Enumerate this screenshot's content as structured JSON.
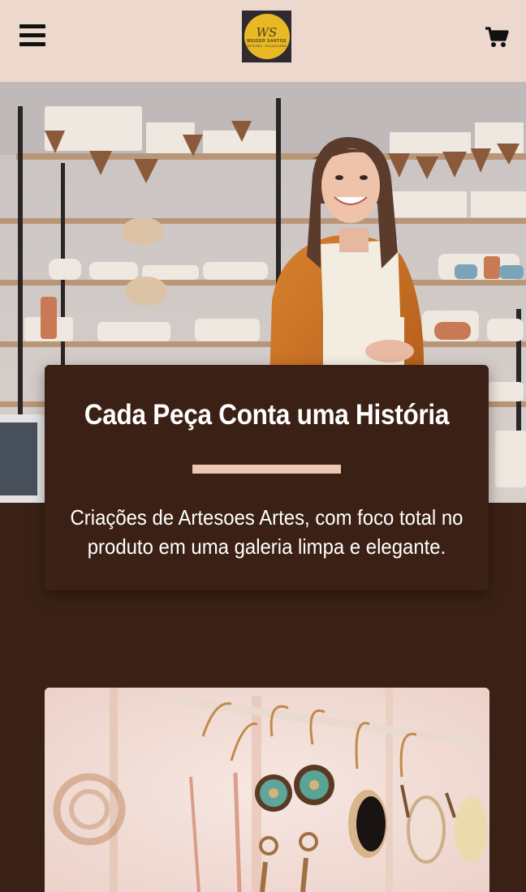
{
  "header": {
    "logo": {
      "monogram": "WS",
      "line1": "WEIDER SANTOS",
      "line2": "ARTESÃO · ESCULTURAS",
      "brand_color": "#e8b925"
    },
    "menu_icon": "hamburger-icon",
    "cart_icon": "shopping-cart-icon",
    "background": "#ecd8cc"
  },
  "hero": {
    "title": "Cada Peça Conta uma História",
    "subtitle": "Criações de Artesoes Artes, com foco total no produto em uma galeria limpa e elegante.",
    "accent_color": "#ecc8b0",
    "card_color": "#3b2115"
  },
  "page": {
    "background": "#3a2115"
  }
}
